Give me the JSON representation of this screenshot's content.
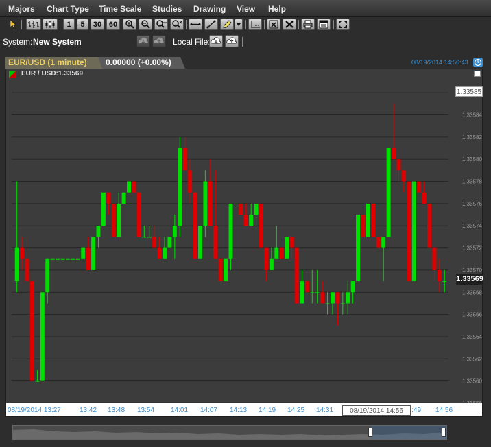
{
  "menu": [
    "Majors",
    "Chart Type",
    "Time Scale",
    "Studies",
    "Drawing",
    "View",
    "Help"
  ],
  "toolbar": {
    "period_buttons": [
      "1",
      "5",
      "30",
      "60"
    ]
  },
  "system": {
    "label": "System:",
    "value": "New System",
    "local_file_label": "Local File:"
  },
  "tab": {
    "title": "EUR/USD (1 minute)",
    "change": "0.00000 (+0.00%)",
    "timestamp": "08/19/2014 14:56:43"
  },
  "legend": {
    "text": "EUR / USD:1.33569"
  },
  "price_labels": {
    "current": "1.33569",
    "highlight": "1.33585"
  },
  "time_cursor": "08/19/2014 14:56",
  "colors": {
    "up": "#00e000",
    "down": "#e00000",
    "background": "#3c3c3c",
    "date_axis_text": "#3b8fd0",
    "price_axis_text": "#9a9a9a"
  },
  "chart_data": {
    "type": "candlestick",
    "symbol": "EUR / USD",
    "x_ticks": [
      "08/19/2014 13:27",
      "13:42",
      "13:48",
      "13:54",
      "14:01",
      "14:07",
      "14:13",
      "14:19",
      "14:25",
      "14:31",
      "14:49",
      "14:56"
    ],
    "y_ticks": [
      "1.33586",
      "1.33584",
      "1.33582",
      "1.33580",
      "1.33578",
      "1.33576",
      "1.33574",
      "1.33572",
      "1.33570",
      "1.33568",
      "1.33566",
      "1.33564",
      "1.33562",
      "1.33560",
      "1.33558"
    ],
    "ylim": [
      1.33558,
      1.33587
    ],
    "grid": true,
    "candles": [
      {
        "o": 1.33569,
        "h": 1.33578,
        "l": 1.33568,
        "c": 1.33572
      },
      {
        "o": 1.33572,
        "h": 1.33573,
        "l": 1.3357,
        "c": 1.33571
      },
      {
        "o": 1.33571,
        "h": 1.33573,
        "l": 1.33569,
        "c": 1.33569
      },
      {
        "o": 1.33569,
        "h": 1.33569,
        "l": 1.3356,
        "c": 1.3356
      },
      {
        "o": 1.3356,
        "h": 1.33561,
        "l": 1.3356,
        "c": 1.3356
      },
      {
        "o": 1.3356,
        "h": 1.33568,
        "l": 1.3356,
        "c": 1.33568
      },
      {
        "o": 1.33568,
        "h": 1.33571,
        "l": 1.33567,
        "c": 1.33571
      },
      {
        "o": 1.33571,
        "h": 1.33571,
        "l": 1.33571,
        "c": 1.33571
      },
      {
        "o": 1.33571,
        "h": 1.33571,
        "l": 1.33571,
        "c": 1.33571
      },
      {
        "o": 1.33571,
        "h": 1.33571,
        "l": 1.33571,
        "c": 1.33571
      },
      {
        "o": 1.33571,
        "h": 1.33571,
        "l": 1.33571,
        "c": 1.33571
      },
      {
        "o": 1.33571,
        "h": 1.33571,
        "l": 1.33571,
        "c": 1.33571
      },
      {
        "o": 1.33571,
        "h": 1.33571,
        "l": 1.33571,
        "c": 1.33571
      },
      {
        "o": 1.33571,
        "h": 1.33572,
        "l": 1.33571,
        "c": 1.33572
      },
      {
        "o": 1.33572,
        "h": 1.33573,
        "l": 1.3357,
        "c": 1.3357
      },
      {
        "o": 1.3357,
        "h": 1.33573,
        "l": 1.3357,
        "c": 1.33573
      },
      {
        "o": 1.33573,
        "h": 1.33574,
        "l": 1.33572,
        "c": 1.33574
      },
      {
        "o": 1.33574,
        "h": 1.33577,
        "l": 1.33574,
        "c": 1.33577
      },
      {
        "o": 1.33577,
        "h": 1.33577,
        "l": 1.33575,
        "c": 1.33576
      },
      {
        "o": 1.33576,
        "h": 1.33576,
        "l": 1.33573,
        "c": 1.33573
      },
      {
        "o": 1.33573,
        "h": 1.33577,
        "l": 1.33573,
        "c": 1.33576
      },
      {
        "o": 1.33576,
        "h": 1.33577,
        "l": 1.33576,
        "c": 1.33577
      },
      {
        "o": 1.33577,
        "h": 1.33578,
        "l": 1.33577,
        "c": 1.33578
      },
      {
        "o": 1.33578,
        "h": 1.33578,
        "l": 1.33577,
        "c": 1.33577
      },
      {
        "o": 1.33577,
        "h": 1.33577,
        "l": 1.33573,
        "c": 1.33573
      },
      {
        "o": 1.33573,
        "h": 1.33574,
        "l": 1.33573,
        "c": 1.33573
      },
      {
        "o": 1.33573,
        "h": 1.33574,
        "l": 1.33573,
        "c": 1.33573
      },
      {
        "o": 1.33573,
        "h": 1.33574,
        "l": 1.33572,
        "c": 1.33572
      },
      {
        "o": 1.33572,
        "h": 1.33573,
        "l": 1.33571,
        "c": 1.33571
      },
      {
        "o": 1.33571,
        "h": 1.33573,
        "l": 1.33571,
        "c": 1.33572
      },
      {
        "o": 1.33572,
        "h": 1.33573,
        "l": 1.33572,
        "c": 1.33573
      },
      {
        "o": 1.33573,
        "h": 1.33575,
        "l": 1.33571,
        "c": 1.33574
      },
      {
        "o": 1.33574,
        "h": 1.33582,
        "l": 1.33573,
        "c": 1.33581
      },
      {
        "o": 1.33581,
        "h": 1.33582,
        "l": 1.33579,
        "c": 1.33579
      },
      {
        "o": 1.33579,
        "h": 1.3358,
        "l": 1.33576,
        "c": 1.33577
      },
      {
        "o": 1.33577,
        "h": 1.33577,
        "l": 1.33571,
        "c": 1.33571
      },
      {
        "o": 1.33571,
        "h": 1.33574,
        "l": 1.33571,
        "c": 1.33574
      },
      {
        "o": 1.33574,
        "h": 1.33579,
        "l": 1.33573,
        "c": 1.33578
      },
      {
        "o": 1.33578,
        "h": 1.3358,
        "l": 1.33574,
        "c": 1.33574
      },
      {
        "o": 1.33574,
        "h": 1.33579,
        "l": 1.33571,
        "c": 1.33571
      },
      {
        "o": 1.33571,
        "h": 1.33571,
        "l": 1.33569,
        "c": 1.33569
      },
      {
        "o": 1.33569,
        "h": 1.33571,
        "l": 1.33569,
        "c": 1.33571
      },
      {
        "o": 1.33571,
        "h": 1.33576,
        "l": 1.3357,
        "c": 1.33576
      },
      {
        "o": 1.33576,
        "h": 1.33576,
        "l": 1.33576,
        "c": 1.33576
      },
      {
        "o": 1.33576,
        "h": 1.33576,
        "l": 1.33575,
        "c": 1.33575
      },
      {
        "o": 1.33575,
        "h": 1.33576,
        "l": 1.33574,
        "c": 1.33574
      },
      {
        "o": 1.33574,
        "h": 1.33576,
        "l": 1.33574,
        "c": 1.33575
      },
      {
        "o": 1.33575,
        "h": 1.33576,
        "l": 1.33574,
        "c": 1.33576
      },
      {
        "o": 1.33576,
        "h": 1.33576,
        "l": 1.33572,
        "c": 1.33572
      },
      {
        "o": 1.33572,
        "h": 1.33572,
        "l": 1.33569,
        "c": 1.3357
      },
      {
        "o": 1.3357,
        "h": 1.33572,
        "l": 1.3357,
        "c": 1.33571
      },
      {
        "o": 1.33571,
        "h": 1.33574,
        "l": 1.33571,
        "c": 1.33572
      },
      {
        "o": 1.33572,
        "h": 1.33572,
        "l": 1.33571,
        "c": 1.33571
      },
      {
        "o": 1.33571,
        "h": 1.33573,
        "l": 1.33571,
        "c": 1.33573
      },
      {
        "o": 1.33573,
        "h": 1.33573,
        "l": 1.33571,
        "c": 1.33572
      },
      {
        "o": 1.33572,
        "h": 1.33572,
        "l": 1.33567,
        "c": 1.33567
      },
      {
        "o": 1.33567,
        "h": 1.3357,
        "l": 1.33567,
        "c": 1.33569
      },
      {
        "o": 1.33569,
        "h": 1.33569,
        "l": 1.33568,
        "c": 1.33568
      },
      {
        "o": 1.33568,
        "h": 1.3357,
        "l": 1.33567,
        "c": 1.33568
      },
      {
        "o": 1.33568,
        "h": 1.3357,
        "l": 1.33567,
        "c": 1.33568
      },
      {
        "o": 1.33568,
        "h": 1.33569,
        "l": 1.33567,
        "c": 1.33567
      },
      {
        "o": 1.33567,
        "h": 1.33568,
        "l": 1.33566,
        "c": 1.33567
      },
      {
        "o": 1.33567,
        "h": 1.33568,
        "l": 1.33566,
        "c": 1.33568
      },
      {
        "o": 1.33568,
        "h": 1.33568,
        "l": 1.33565,
        "c": 1.33567
      },
      {
        "o": 1.33567,
        "h": 1.33568,
        "l": 1.33566,
        "c": 1.33567
      },
      {
        "o": 1.33567,
        "h": 1.33569,
        "l": 1.33566,
        "c": 1.33568
      },
      {
        "o": 1.33568,
        "h": 1.33569,
        "l": 1.33567,
        "c": 1.33569
      },
      {
        "o": 1.33569,
        "h": 1.33575,
        "l": 1.33569,
        "c": 1.33575
      },
      {
        "o": 1.33575,
        "h": 1.33575,
        "l": 1.33573,
        "c": 1.33573
      },
      {
        "o": 1.33573,
        "h": 1.33576,
        "l": 1.33573,
        "c": 1.33576
      },
      {
        "o": 1.33576,
        "h": 1.33576,
        "l": 1.33573,
        "c": 1.33573
      },
      {
        "o": 1.33573,
        "h": 1.33573,
        "l": 1.33572,
        "c": 1.33572
      },
      {
        "o": 1.33572,
        "h": 1.33573,
        "l": 1.33569,
        "c": 1.33573
      },
      {
        "o": 1.33573,
        "h": 1.33581,
        "l": 1.33573,
        "c": 1.33581
      },
      {
        "o": 1.33581,
        "h": 1.33585,
        "l": 1.3358,
        "c": 1.3358
      },
      {
        "o": 1.3358,
        "h": 1.3358,
        "l": 1.33578,
        "c": 1.33579
      },
      {
        "o": 1.33579,
        "h": 1.33579,
        "l": 1.33577,
        "c": 1.33578
      },
      {
        "o": 1.33578,
        "h": 1.33578,
        "l": 1.33569,
        "c": 1.33569
      },
      {
        "o": 1.33569,
        "h": 1.33578,
        "l": 1.33569,
        "c": 1.33578
      },
      {
        "o": 1.33578,
        "h": 1.33578,
        "l": 1.33577,
        "c": 1.33577
      },
      {
        "o": 1.33577,
        "h": 1.33578,
        "l": 1.33576,
        "c": 1.33576
      },
      {
        "o": 1.33576,
        "h": 1.33576,
        "l": 1.33572,
        "c": 1.33572
      },
      {
        "o": 1.33572,
        "h": 1.33572,
        "l": 1.33569,
        "c": 1.3357
      },
      {
        "o": 1.3357,
        "h": 1.33571,
        "l": 1.33568,
        "c": 1.33569
      },
      {
        "o": 1.33569,
        "h": 1.3357,
        "l": 1.33568,
        "c": 1.33569
      }
    ]
  }
}
